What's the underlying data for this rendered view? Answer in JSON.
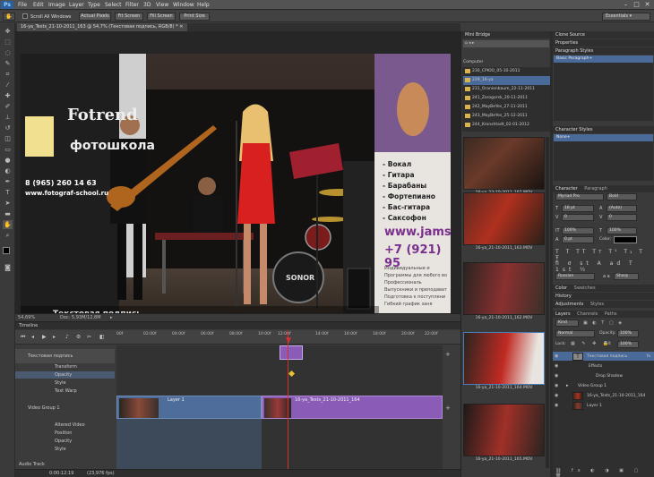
{
  "app": {
    "logo": "Ps",
    "menu": [
      "File",
      "Edit",
      "Image",
      "Layer",
      "Type",
      "Select",
      "Filter",
      "3D",
      "View",
      "Window",
      "Help"
    ],
    "window_controls": [
      "–",
      "□",
      "✕"
    ]
  },
  "options_bar": {
    "scroll_all": "Scroll All Windows",
    "buttons": [
      "Actual Pixels",
      "Fit Screen",
      "Fill Screen",
      "Print Size"
    ],
    "workspace": "Essentials"
  },
  "document": {
    "tab_title": "16-ya_Tests_21-10-2011_163 @ 54,7% (Текстовая подпись, RGB/8) *",
    "zoom": "54,69%",
    "doc_info": "Doc: 5,93M/12,8M",
    "overlay_caption": "Текстовая подпись",
    "banner_left_1": "Fotrend",
    "banner_left_2": "фотошкола",
    "banner_left_phone": "8 (965) 260 14 63",
    "banner_left_site": "www.fotograf-school.ru",
    "banner_right_list": [
      "- Вокал",
      "- Гитара",
      "- Барабаны",
      "- Фортепиано",
      "- Бас-гитара",
      "- Саксофон"
    ],
    "banner_right_site": "www.jams",
    "banner_right_phone": "+7 (921) 95",
    "banner_right_sub": [
      "Индивидуальные и",
      "Программы для любого во",
      "Профессиональ",
      "Выпускники и преподават",
      "Подготовка к поступлени",
      "Гибкий график заня"
    ],
    "drum_brand": "SONOR"
  },
  "timeline": {
    "title": "Timeline",
    "timecode": "0:00:12:19",
    "fps": "(23,976 fps)",
    "ruler": [
      "00f",
      "02:00f",
      "04:00f",
      "06:00f",
      "08:00f",
      "10:00f",
      "12:00f",
      "14:00f",
      "16:00f",
      "18:00f",
      "20:00f",
      "22:00f"
    ],
    "layers": [
      {
        "name": "Текстовая подпись",
        "type": "group"
      },
      {
        "name": "Transform",
        "type": "prop"
      },
      {
        "name": "Opacity",
        "type": "prop"
      },
      {
        "name": "Style",
        "type": "prop"
      },
      {
        "name": "Text Warp",
        "type": "prop"
      },
      {
        "name": "Video Group 1",
        "type": "group"
      },
      {
        "name": "Altered Video",
        "type": "prop"
      },
      {
        "name": "Position",
        "type": "prop"
      },
      {
        "name": "Opacity",
        "type": "prop"
      },
      {
        "name": "Style",
        "type": "prop"
      }
    ],
    "clip1": "Layer 1",
    "clip2": "16-ya_Tests_21-10-2011_164",
    "audio_track": "Audio Track"
  },
  "mini_bridge": {
    "title": "Mini Bridge",
    "nav": "Computer",
    "folders": [
      "230_СРЮО_05-10-2011",
      "229_16-ya",
      "231_Oranienbaum_22-11-2011",
      "241_Zarogorsk_20-11-2011",
      "242_MayBeYes_27-11-2011",
      "243_MayBeYes_25-12-2011",
      "244_Kronshtadt_02-01-2012"
    ],
    "thumbs": [
      "16-ya_23-10-2011_167.MOV",
      "16-ya_21-10-2011_163.MOV",
      "16-ya_21-10-2011_162.MOV",
      "16-ya_21-10-2011_164.MOV",
      "16-ya_21-10-2011_165.MOV"
    ]
  },
  "right": {
    "clone_source": "Clone Source",
    "properties": "Properties",
    "paragraph_styles": "Paragraph Styles",
    "basic_paragraph": "Basic Paragraph+",
    "character_styles": "Character Styles",
    "none": "None+",
    "character_tab": "Character",
    "paragraph_tab": "Paragraph",
    "font_family": "Myriad Pro",
    "font_style": "Bold",
    "size": "18 pt",
    "leading": "(Auto)",
    "kerning": "0",
    "tracking": "0",
    "v_scale": "100%",
    "h_scale": "100%",
    "baseline": "0 pt",
    "color_label": "Color:",
    "language": "Russian",
    "aa_label": "a a",
    "aa": "Sharp",
    "color_tab": "Color",
    "swatches_tab": "Swatches",
    "history": "History",
    "adjustments": "Adjustments",
    "styles": "Styles",
    "layers_tab": "Layers",
    "channels_tab": "Channels",
    "paths_tab": "Paths",
    "kind": "Kind",
    "blend": "Normal",
    "opacity_label": "Opacity:",
    "opacity": "100%",
    "lock_label": "Lock:",
    "fill_label": "Fill:",
    "fill": "100%",
    "layers": [
      {
        "name": "Текстовая подпись",
        "fx": "fx",
        "selected": true,
        "indent": 1
      },
      {
        "name": "Effects",
        "indent": 2
      },
      {
        "name": "Drop Shadow",
        "indent": 3
      },
      {
        "name": "Video Group 1",
        "indent": 0
      },
      {
        "name": "16-ya_Tests_21-10-2011_164",
        "indent": 1
      },
      {
        "name": "Layer 1",
        "indent": 1
      }
    ]
  },
  "colors": {
    "accent": "#4a7cb8",
    "clip_blue": "#4f6d9a",
    "clip_purple": "#8a5cb8",
    "playhead": "#d43030"
  }
}
